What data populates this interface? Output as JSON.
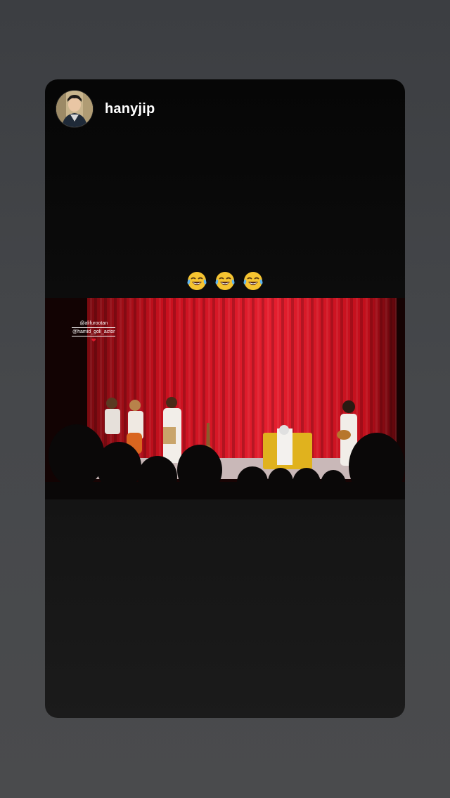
{
  "story": {
    "username": "hanyjip",
    "avatar_icon": "profile-avatar-icon",
    "caption_emojis": [
      "face-with-tears-of-joy-icon",
      "face-with-tears-of-joy-icon",
      "face-with-tears-of-joy-icon"
    ],
    "video": {
      "mentions": [
        "@alifurootan",
        "@hamid_goli_actor"
      ],
      "heart": "❤"
    }
  },
  "colors": {
    "background": "#424447",
    "card": "#0c0c0c",
    "curtain": "#c8101e",
    "username": "#ffffff"
  }
}
